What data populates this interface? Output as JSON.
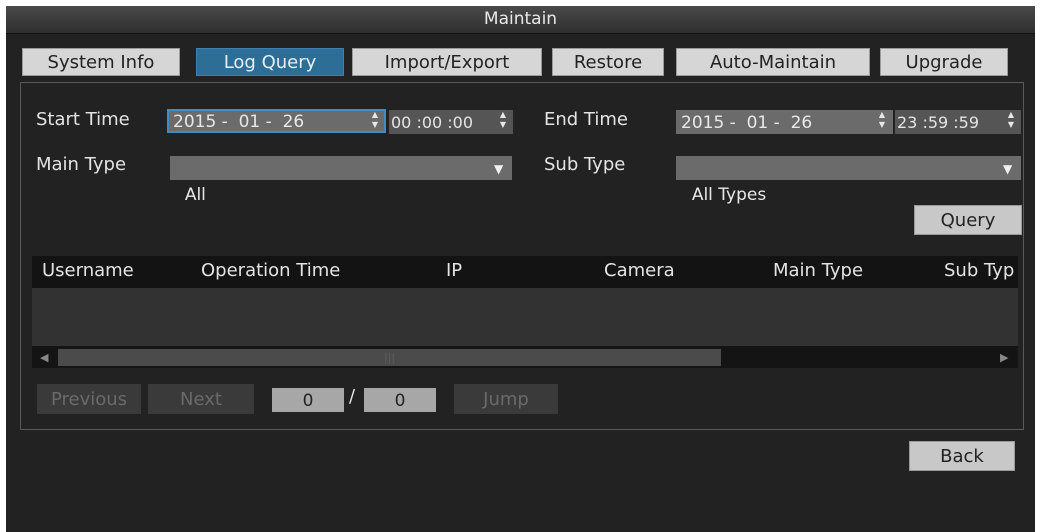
{
  "window": {
    "title": "Maintain"
  },
  "tabs": [
    {
      "label": "System Info"
    },
    {
      "label": "Log Query"
    },
    {
      "label": "Import/Export"
    },
    {
      "label": "Restore"
    },
    {
      "label": "Auto-Maintain"
    },
    {
      "label": "Upgrade"
    }
  ],
  "filters": {
    "start_time_label": "Start Time",
    "start_date": "2015 -  01 -  26",
    "start_clock": "00 :00 :00",
    "end_time_label": "End Time",
    "end_date": "2015 -  01 -  26",
    "end_clock": "23 :59 :59",
    "main_type_label": "Main Type",
    "main_type_value": "All",
    "sub_type_label": "Sub Type",
    "sub_type_value": "All Types",
    "query_button": "Query"
  },
  "table": {
    "columns": [
      "Username",
      "Operation Time",
      "IP",
      "Camera",
      "Main Type",
      "Sub Typ"
    ],
    "rows": []
  },
  "pagination": {
    "previous": "Previous",
    "next": "Next",
    "current_page": "0",
    "separator": "/",
    "total_pages": "0",
    "jump": "Jump"
  },
  "footer": {
    "back_button": "Back"
  },
  "colors": {
    "accent": "#2d6e97",
    "background": "#222222"
  }
}
